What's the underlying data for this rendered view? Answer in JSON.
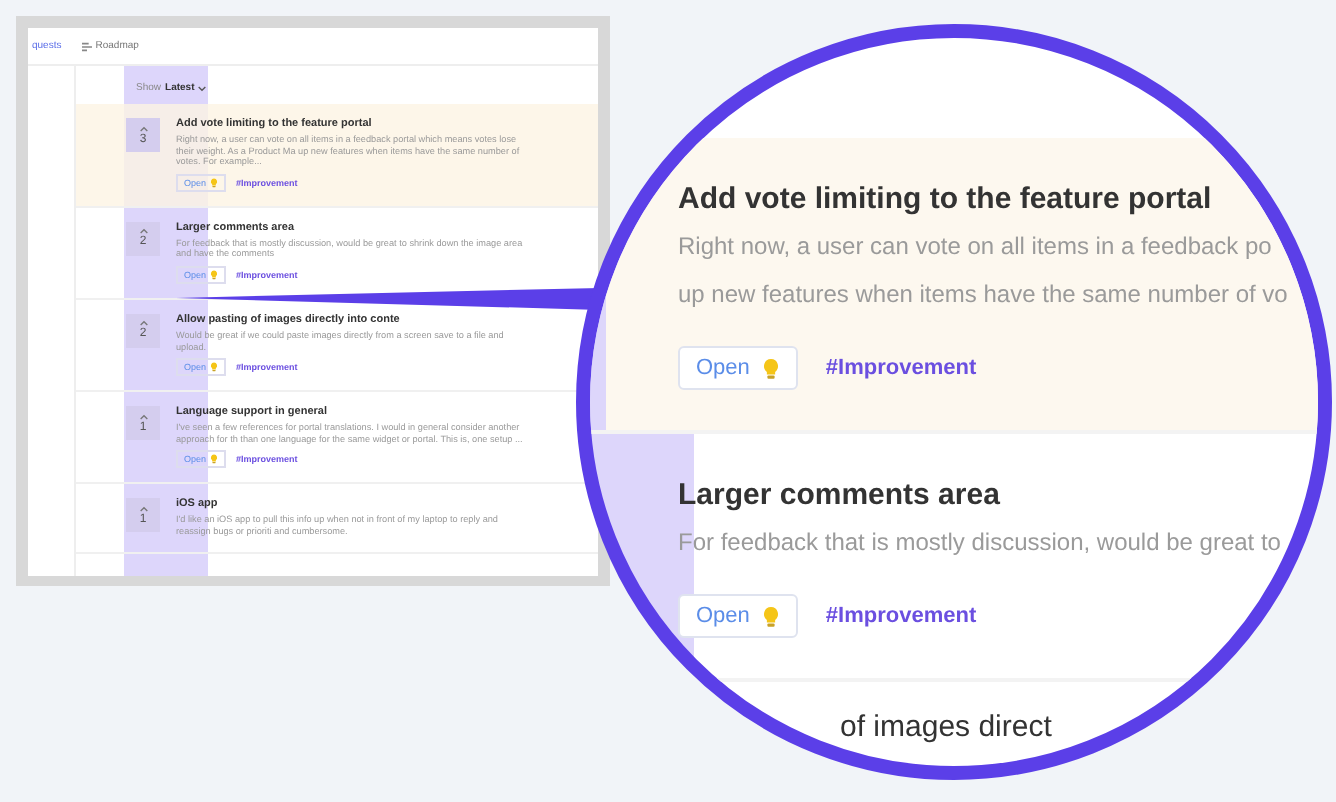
{
  "portal": {
    "nav": [
      {
        "label": "quests",
        "selected": true
      },
      {
        "label": "Roadmap",
        "selected": false
      }
    ],
    "sort": {
      "label": "Show",
      "value": "Latest"
    },
    "items": [
      {
        "votes": "3",
        "title": "Add vote limiting to the feature portal",
        "description": "Right now, a user can vote on all items in a feedback portal which means votes lose their weight. As a Product Ma up new features when items have the same number of votes. For example...",
        "status": "Open",
        "tag": "#Improvement",
        "highlighted": true
      },
      {
        "votes": "2",
        "title": "Larger comments area",
        "description": "For feedback that is mostly discussion, would be great to shrink down the image area and have the comments",
        "status": "Open",
        "tag": "#Improvement",
        "highlighted": false
      },
      {
        "votes": "2",
        "title": "Allow pasting of images directly into conte",
        "description": "Would be great if we could paste images directly from a screen save to a file and upload.",
        "status": "Open",
        "tag": "#Improvement",
        "highlighted": false
      },
      {
        "votes": "1",
        "title": "Language support in general",
        "description": "I've seen a few references for portal translations. I would in general consider another approach for th than one language for the same widget or portal. This is, one setup ...",
        "status": "Open",
        "tag": "#Improvement",
        "highlighted": false
      },
      {
        "votes": "1",
        "title": "iOS app",
        "description": "I'd like an iOS app to pull this info up when not in front of my laptop to reply and reassign bugs or prioriti and cumbersome.",
        "highlighted": false
      }
    ]
  },
  "magnifier": {
    "items": [
      {
        "title": "Add vote limiting to the feature portal",
        "description_lines": [
          "Right now, a user can vote on all items in a feedback po",
          "up new features when items have the same number of vo"
        ],
        "status": "Open",
        "tag": "#Improvement",
        "highlighted": true
      },
      {
        "title": "Larger comments area",
        "description_lines": [
          "For feedback that is mostly discussion, would be great to"
        ],
        "status": "Open",
        "tag": "#Improvement",
        "highlighted": false
      }
    ],
    "cut_title": "of images direct"
  }
}
